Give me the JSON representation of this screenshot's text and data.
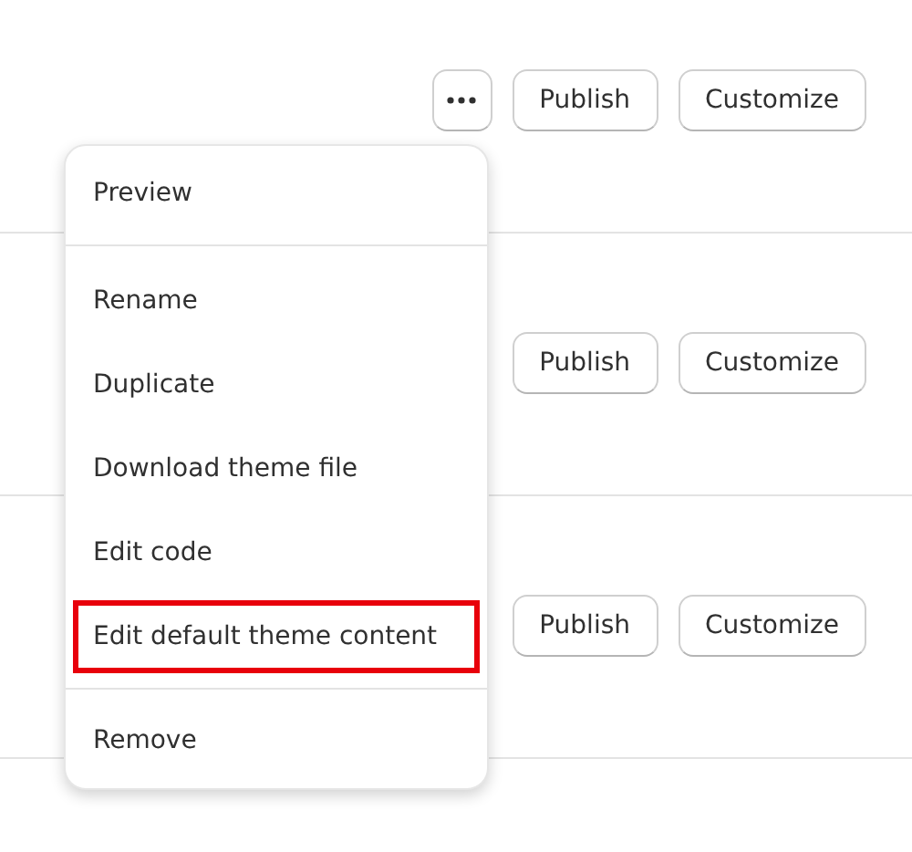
{
  "rows": [
    {
      "more_button": true,
      "buttons": [
        "Publish",
        "Customize"
      ]
    },
    {
      "buttons": [
        "Publish",
        "Customize"
      ]
    },
    {
      "buttons": [
        "Publish",
        "Customize"
      ]
    }
  ],
  "menu": {
    "sections": [
      [
        {
          "label": "Preview",
          "highlighted": false
        }
      ],
      [
        {
          "label": "Rename",
          "highlighted": false
        },
        {
          "label": "Duplicate",
          "highlighted": false
        },
        {
          "label": "Download theme file",
          "highlighted": false
        },
        {
          "label": "Edit code",
          "highlighted": false
        },
        {
          "label": "Edit default theme content",
          "highlighted": true
        }
      ],
      [
        {
          "label": "Remove",
          "highlighted": false
        }
      ]
    ]
  }
}
